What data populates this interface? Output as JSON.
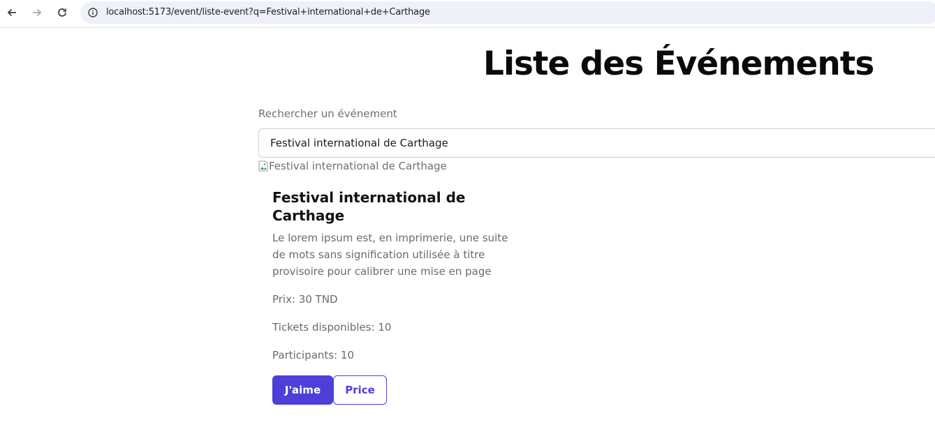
{
  "browser": {
    "url": "localhost:5173/event/liste-event?q=Festival+international+de+Carthage"
  },
  "page": {
    "title": "Liste des Événements",
    "search": {
      "label": "Rechercher un événement",
      "value": "Festival international de Carthage"
    },
    "event": {
      "image_alt": "Festival international de Carthage",
      "title": "Festival international de Carthage",
      "description": "Le lorem ipsum est, en imprimerie, une suite de mots sans signification utilisée à titre provisoire pour calibrer une mise en page",
      "price": "Prix: 30 TND",
      "tickets": "Tickets disponibles: 10",
      "participants": "Participants: 10",
      "like_label": "J'aime",
      "price_label": "Price"
    }
  },
  "colors": {
    "accent": "#4f3fd8",
    "title": "#0a0a0a",
    "muted_text": "#6b6b6b"
  }
}
